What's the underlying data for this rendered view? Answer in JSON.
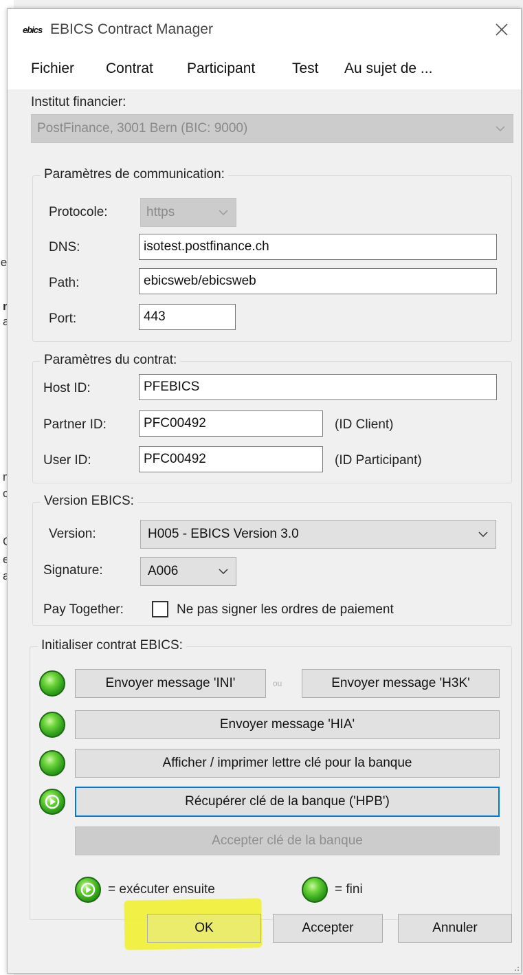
{
  "background_fragments": [
    ":e",
    "n",
    "a",
    "n",
    "c",
    "C",
    "e",
    "a"
  ],
  "window": {
    "title": "EBICS Contract Manager",
    "logo_text": "ebics"
  },
  "menu": [
    "Fichier",
    "Contrat",
    "Participant",
    "Test",
    "Au sujet de ..."
  ],
  "financial_institution": {
    "label": "Institut financier:",
    "value": "PostFinance, 3001 Bern (BIC: 9000)"
  },
  "communication": {
    "title": "Paramètres de communication:",
    "protocol_label": "Protocole:",
    "protocol_value": "https",
    "dns_label": "DNS:",
    "dns_value": "isotest.postfinance.ch",
    "path_label": "Path:",
    "path_value": "ebicsweb/ebicsweb",
    "port_label": "Port:",
    "port_value": "443"
  },
  "contract": {
    "title": "Paramètres du contrat:",
    "host_label": "Host ID:",
    "host_value": "PFEBICS",
    "partner_label": "Partner ID:",
    "partner_value": "PFC00492",
    "partner_note": "(ID Client)",
    "user_label": "User ID:",
    "user_value": "PFC00492",
    "user_note": "(ID Participant)"
  },
  "version": {
    "title": "Version EBICS:",
    "version_label": "Version:",
    "version_value": "H005 - EBICS Version 3.0",
    "signature_label": "Signature:",
    "signature_value": "A006",
    "pay_together_label": "Pay Together:",
    "pay_together_checkbox_label": "Ne pas signer les ordres de paiement",
    "pay_together_checked": false
  },
  "init": {
    "title": "Initialiser contrat EBICS:",
    "btn_ini": "Envoyer message 'INI'",
    "or_text": "ou",
    "btn_h3k": "Envoyer message 'H3K'",
    "btn_hia": "Envoyer message 'HIA'",
    "btn_letter": "Afficher / imprimer lettre clé pour la banque",
    "btn_hpb": "Récupérer clé de la banque ('HPB')",
    "btn_accept_key": "Accepter clé de la banque",
    "legend_next": "= exécuter ensuite",
    "legend_done": "= fini"
  },
  "footer": {
    "ok": "OK",
    "accept": "Accepter",
    "cancel": "Annuler"
  },
  "colors": {
    "led_green": "#2f9e1a",
    "focus_blue": "#0078d7",
    "highlight_yellow": "#f0f028"
  }
}
